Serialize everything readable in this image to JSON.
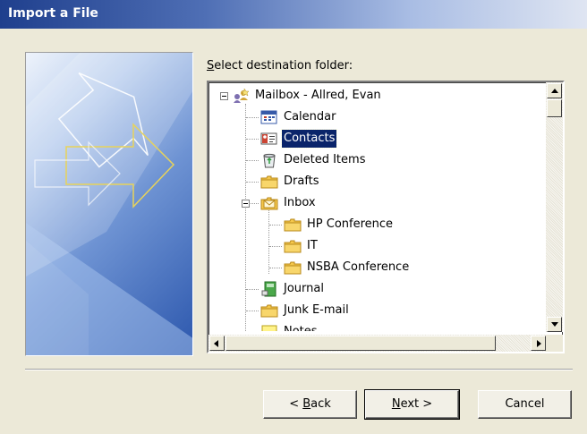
{
  "window": {
    "title": "Import a File"
  },
  "folder_picker": {
    "label_accel": "S",
    "label_rest": "elect destination folder:"
  },
  "tree": {
    "root": "Mailbox - Allred, Evan",
    "items": [
      {
        "label": "Calendar",
        "icon": "calendar-icon"
      },
      {
        "label": "Contacts",
        "icon": "contacts-icon",
        "selected": true
      },
      {
        "label": "Deleted Items",
        "icon": "deleted-items-icon"
      },
      {
        "label": "Drafts",
        "icon": "folder-icon"
      },
      {
        "label": "Inbox",
        "icon": "inbox-icon"
      },
      {
        "label": "HP Conference",
        "icon": "folder-icon"
      },
      {
        "label": "IT",
        "icon": "folder-icon"
      },
      {
        "label": "NSBA Conference",
        "icon": "folder-icon"
      },
      {
        "label": "Journal",
        "icon": "journal-icon"
      },
      {
        "label": "Junk E-mail",
        "icon": "folder-icon"
      },
      {
        "label": "Notes",
        "icon": "notes-icon"
      }
    ]
  },
  "buttons": {
    "back_pre": "< ",
    "back_accel": "B",
    "back_rest": "ack",
    "next_accel": "N",
    "next_rest": "ext >",
    "cancel": "Cancel"
  },
  "colors": {
    "selection": "#0a246a",
    "dialog_bg": "#ece9d8"
  }
}
